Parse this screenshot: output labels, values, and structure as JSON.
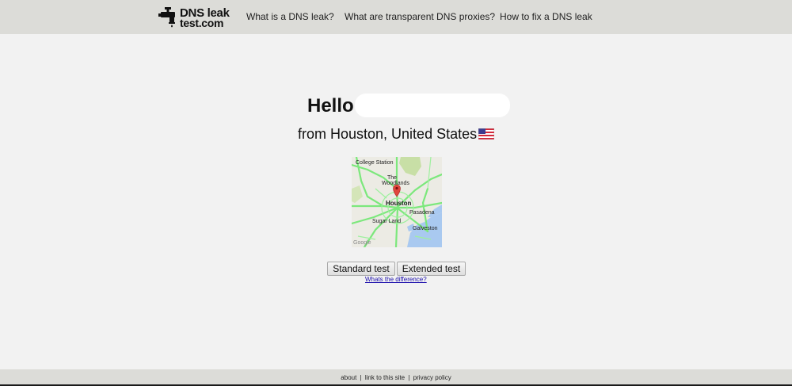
{
  "header": {
    "logo": {
      "line1": "DNS leak",
      "line2": "test.com",
      "icon": "faucet-icon"
    },
    "nav": [
      {
        "label": "What is a DNS leak?"
      },
      {
        "label": "What are transparent DNS proxies?"
      },
      {
        "label": "How to fix a DNS leak"
      }
    ]
  },
  "main": {
    "greeting": "Hello",
    "location_text": "from Houston, United States",
    "flag_icon": "us-flag-icon",
    "map": {
      "labels": {
        "college_station": "College Station",
        "the": "The",
        "woodlands": "Woodlands",
        "houston": "Houston",
        "pasadena": "Pasadena",
        "sugar_land": "Sugar Land",
        "galveston": "Galveston"
      },
      "attribution": "Google",
      "marker_icon": "map-pin-icon"
    },
    "buttons": {
      "standard": "Standard test",
      "extended": "Extended test"
    },
    "difference_link": "Whats the difference?"
  },
  "footer": {
    "about": "about",
    "link_to_site": "link to this site",
    "privacy": "privacy policy",
    "separator": "|"
  },
  "colors": {
    "topbar": "#dcdcd8",
    "background": "#f2f2f2",
    "link": "#1a0dab",
    "map_roads": "#7ce87c",
    "map_water": "#a9c9f0"
  }
}
